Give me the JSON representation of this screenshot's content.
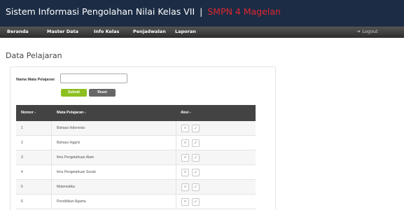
{
  "header": {
    "title": "Sistem Informasi Pengolahan Nilai Kelas VII",
    "separator": "|",
    "school": "SMPN 4 Magelan"
  },
  "nav": {
    "items": [
      "Beranda",
      "Master Data",
      "Info Kelas",
      "Penjadwalan",
      "Laporan"
    ],
    "logout_label": "Logout"
  },
  "page": {
    "title": "Data Pelajaran"
  },
  "form": {
    "label": "Nama Mata Pelajaran",
    "input_value": "",
    "submit_label": "Submit",
    "reset_label": "Reset"
  },
  "table": {
    "headers": [
      "Nomor -",
      "Mata Pelajaran -",
      "Aksi -"
    ],
    "rows": [
      {
        "no": "1",
        "subject": "Bahasa Indonesia"
      },
      {
        "no": "2",
        "subject": "Bahasa Inggris"
      },
      {
        "no": "3",
        "subject": "Ilmu Pengetahuan Alam"
      },
      {
        "no": "4",
        "subject": "Ilmu Pengetahuan Sosial"
      },
      {
        "no": "5",
        "subject": "Matematika"
      },
      {
        "no": "6",
        "subject": "Pendidikan Agama"
      }
    ]
  },
  "colors": {
    "header_bg": "#1c2c45",
    "school_accent": "#e0262e",
    "submit_green": "#8dbf1f",
    "table_header": "#434343"
  },
  "icons": {
    "delete": "close-icon",
    "edit": "check-icon",
    "logout": "logout-arrow-icon"
  }
}
